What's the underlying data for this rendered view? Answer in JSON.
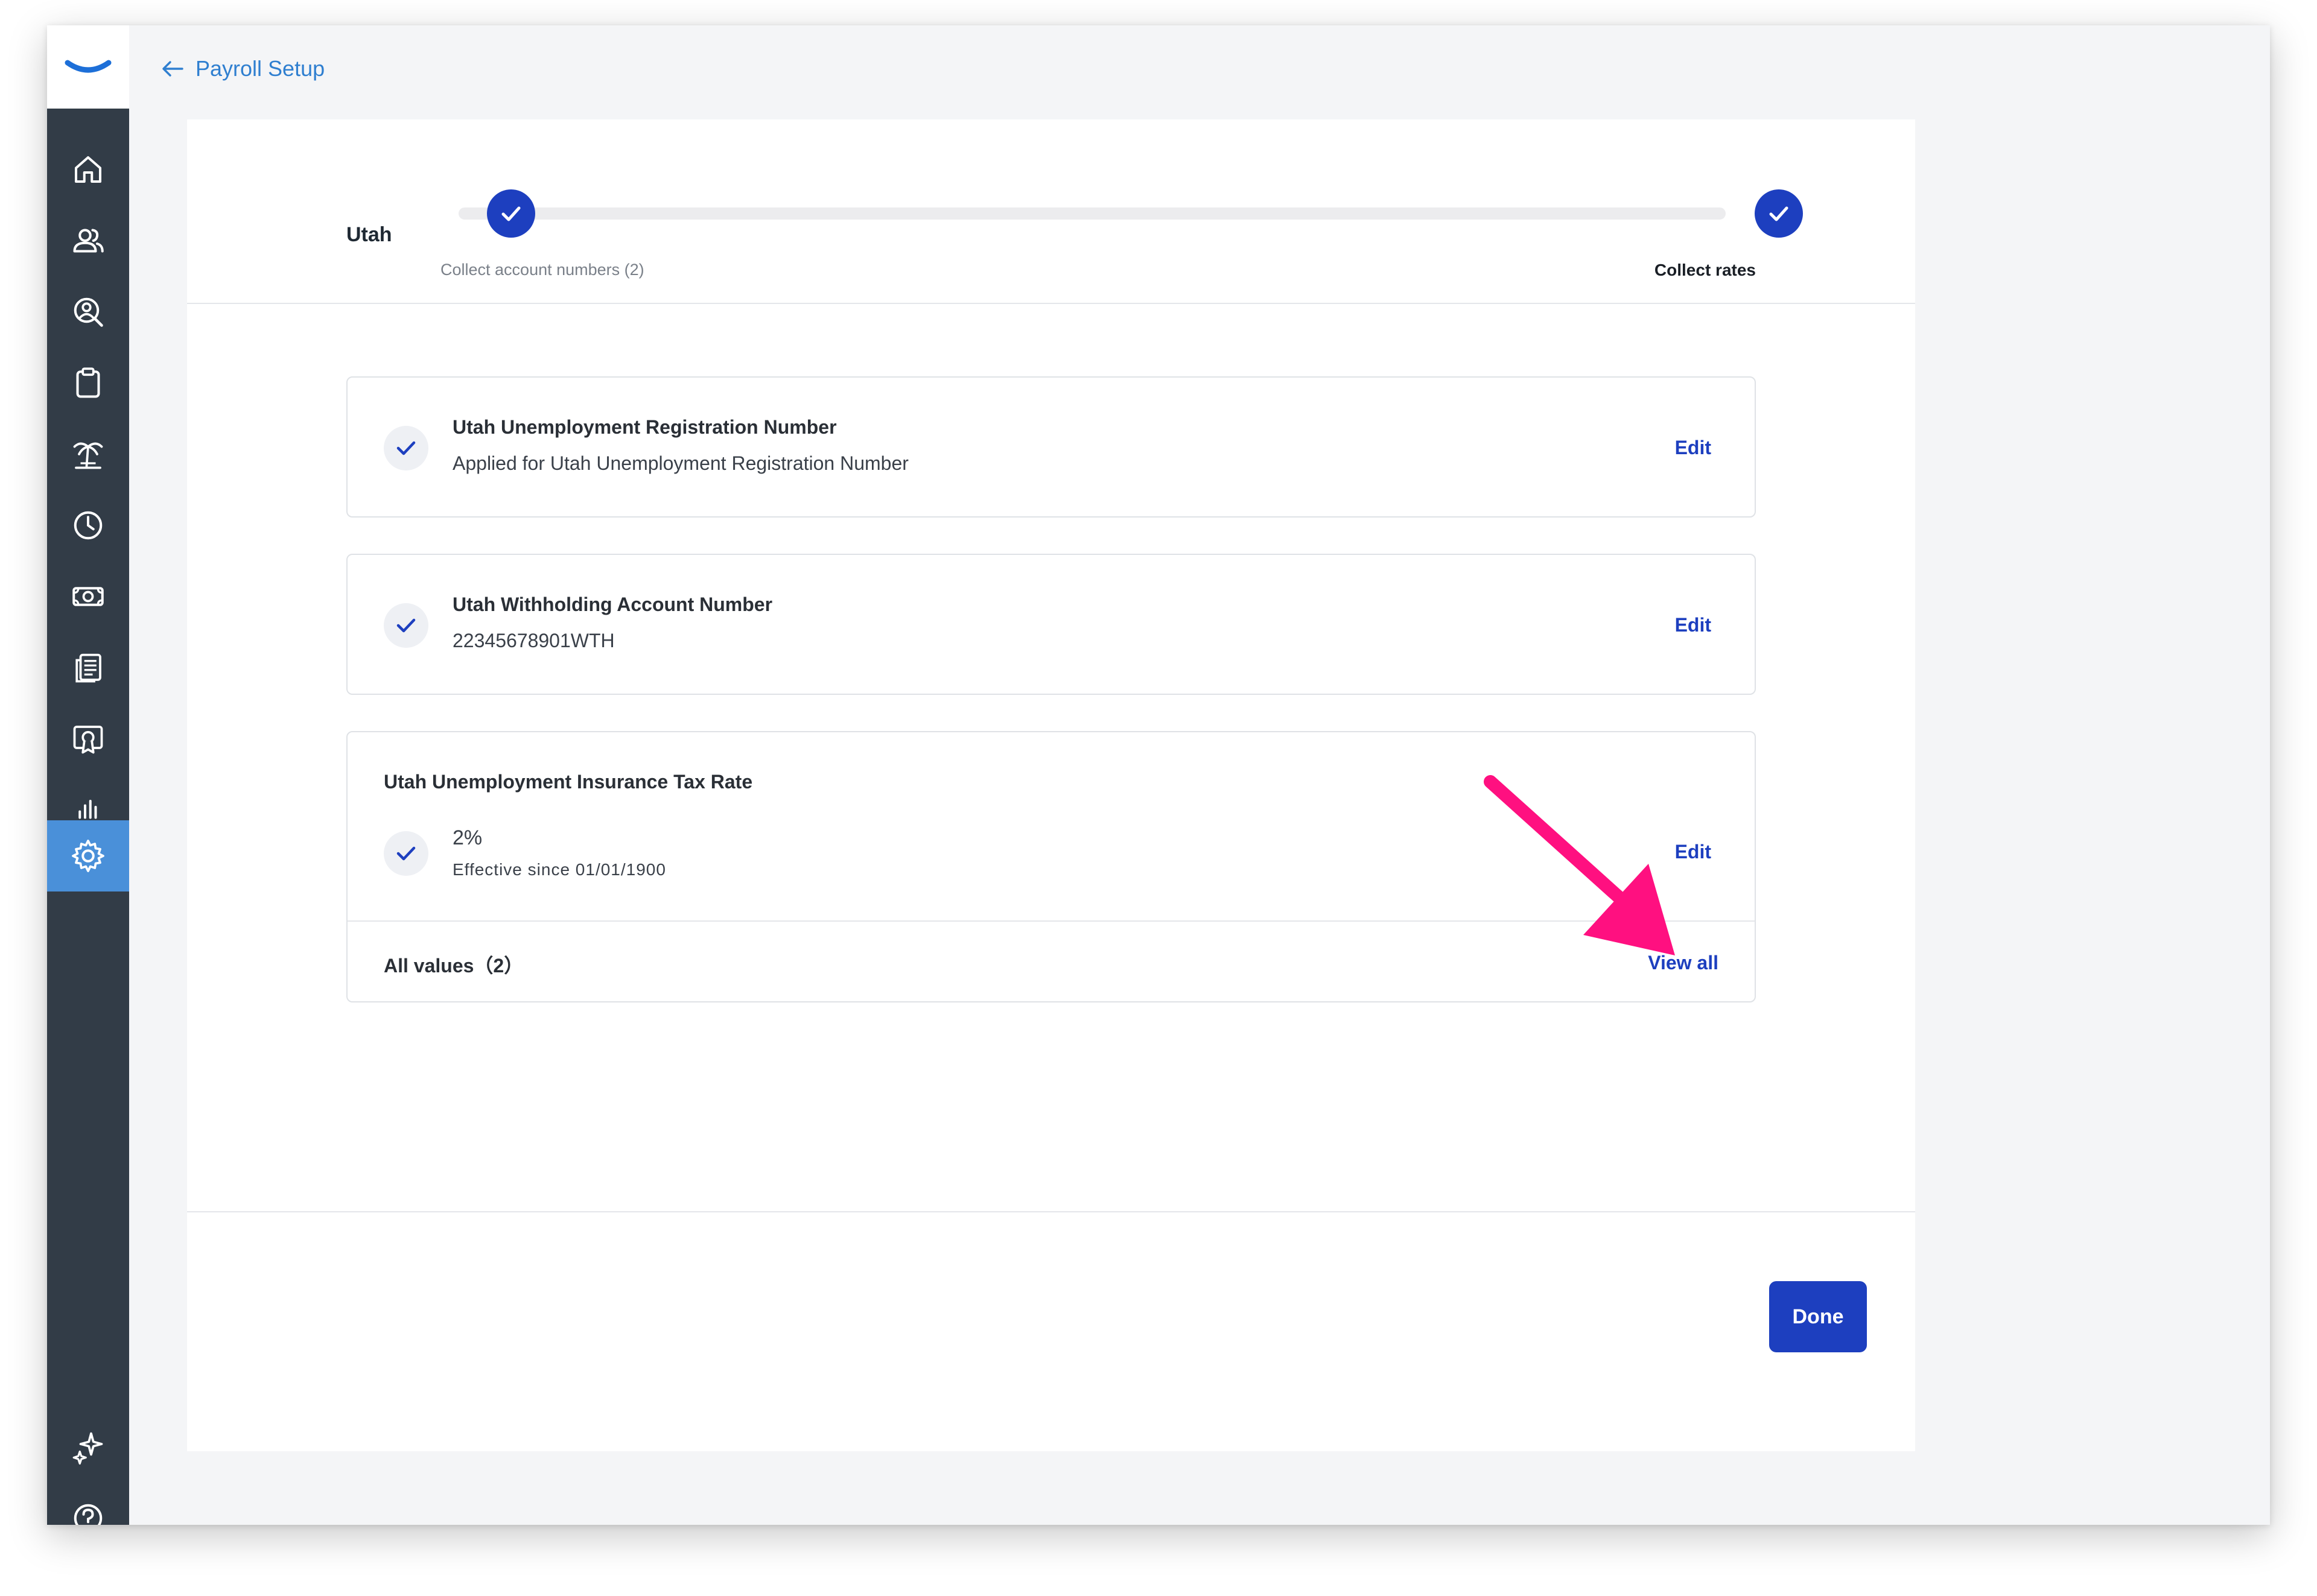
{
  "header": {
    "back_label": "Payroll Setup"
  },
  "sidebar": {
    "items": [
      {
        "icon": "home-icon"
      },
      {
        "icon": "people-icon"
      },
      {
        "icon": "person-search-icon"
      },
      {
        "icon": "clipboard-icon"
      },
      {
        "icon": "palm-tree-icon"
      },
      {
        "icon": "clock-icon"
      },
      {
        "icon": "money-icon"
      },
      {
        "icon": "documents-icon"
      },
      {
        "icon": "certificate-icon"
      },
      {
        "icon": "bar-chart-icon"
      },
      {
        "icon": "gear-icon",
        "active": true
      }
    ],
    "bottom": [
      {
        "icon": "sparkle-icon"
      },
      {
        "icon": "help-icon"
      }
    ]
  },
  "progress": {
    "state": "Utah",
    "steps": [
      {
        "label": "Collect account numbers (2)",
        "status": "complete"
      },
      {
        "label": "Collect rates",
        "status": "complete"
      }
    ]
  },
  "cards": {
    "unemployment_reg": {
      "title": "Utah Unemployment Registration Number",
      "subtitle": "Applied for Utah Unemployment Registration Number",
      "edit": "Edit"
    },
    "withholding": {
      "title": "Utah Withholding Account Number",
      "subtitle": "22345678901WTH",
      "edit": "Edit"
    },
    "tax_rate": {
      "title": "Utah Unemployment Insurance Tax Rate",
      "value": "2%",
      "effective": "Effective since 01/01/1900",
      "edit": "Edit",
      "all_values": "All values（2）",
      "view_all": "View all"
    }
  },
  "footer": {
    "done_label": "Done"
  },
  "colors": {
    "primary": "#1d3fbf",
    "sidebar": "#323c47",
    "active_nav": "#4a90d9",
    "link": "#2f7fd0",
    "annotation": "#ff1080"
  }
}
